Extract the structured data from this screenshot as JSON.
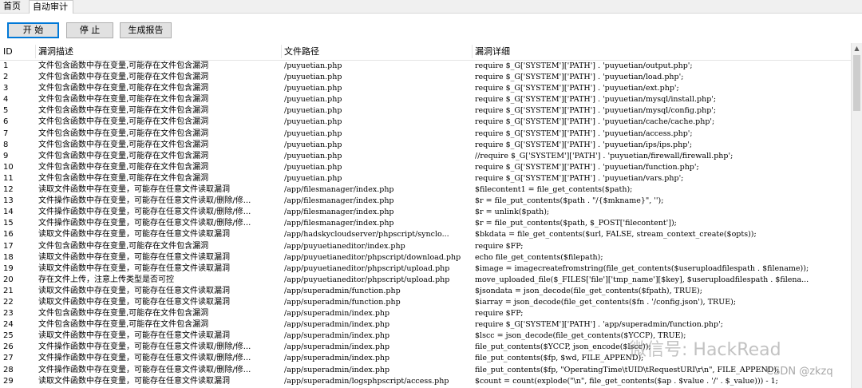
{
  "tabs": [
    {
      "label": "首页"
    },
    {
      "label": "自动审计"
    }
  ],
  "toolbar": {
    "start_label": "开 始",
    "stop_label": "停 止",
    "report_label": "生成报告"
  },
  "table": {
    "columns": [
      "ID",
      "漏洞描述",
      "文件路径",
      "漏洞详细"
    ],
    "rows": [
      [
        "1",
        "文件包含函数中存在变量,可能存在文件包含漏洞",
        "/puyuetian.php",
        "require $_G['SYSTEM']['PATH'] . 'puyuetian/output.php';"
      ],
      [
        "2",
        "文件包含函数中存在变量,可能存在文件包含漏洞",
        "/puyuetian.php",
        "require $_G['SYSTEM']['PATH'] . 'puyuetian/load.php';"
      ],
      [
        "3",
        "文件包含函数中存在变量,可能存在文件包含漏洞",
        "/puyuetian.php",
        "require $_G['SYSTEM']['PATH'] . 'puyuetian/ext.php';"
      ],
      [
        "4",
        "文件包含函数中存在变量,可能存在文件包含漏洞",
        "/puyuetian.php",
        "require $_G['SYSTEM']['PATH'] . 'puyuetian/mysql/install.php';"
      ],
      [
        "5",
        "文件包含函数中存在变量,可能存在文件包含漏洞",
        "/puyuetian.php",
        "require $_G['SYSTEM']['PATH'] . 'puyuetian/mysql/config.php';"
      ],
      [
        "6",
        "文件包含函数中存在变量,可能存在文件包含漏洞",
        "/puyuetian.php",
        "require $_G['SYSTEM']['PATH'] . 'puyuetian/cache/cache.php';"
      ],
      [
        "7",
        "文件包含函数中存在变量,可能存在文件包含漏洞",
        "/puyuetian.php",
        "require $_G['SYSTEM']['PATH'] . 'puyuetian/access.php';"
      ],
      [
        "8",
        "文件包含函数中存在变量,可能存在文件包含漏洞",
        "/puyuetian.php",
        "require $_G['SYSTEM']['PATH'] . 'puyuetian/ips/ips.php';"
      ],
      [
        "9",
        "文件包含函数中存在变量,可能存在文件包含漏洞",
        "/puyuetian.php",
        "//require $_G['SYSTEM']['PATH'] . 'puyuetian/firewall/firewall.php';"
      ],
      [
        "10",
        "文件包含函数中存在变量,可能存在文件包含漏洞",
        "/puyuetian.php",
        "require $_G['SYSTEM']['PATH'] . 'puyuetian/function.php';"
      ],
      [
        "11",
        "文件包含函数中存在变量,可能存在文件包含漏洞",
        "/puyuetian.php",
        "require $_G['SYSTEM']['PATH'] . 'puyuetian/vars.php';"
      ],
      [
        "12",
        "读取文件函数中存在变量，可能存在任意文件读取漏洞",
        "/app/filesmanager/index.php",
        "$filecontent1 = file_get_contents($path);"
      ],
      [
        "13",
        "文件操作函数中存在变量，可能存在任意文件读取/删除/修...",
        "/app/filesmanager/index.php",
        "$r = file_put_contents($path . \"/{$mkname}\", '');"
      ],
      [
        "14",
        "文件操作函数中存在变量，可能存在任意文件读取/删除/修...",
        "/app/filesmanager/index.php",
        "$r = unlink($path);"
      ],
      [
        "15",
        "文件操作函数中存在变量，可能存在任意文件读取/删除/修...",
        "/app/filesmanager/index.php",
        "$r = file_put_contents($path, $_POST['filecontent']);"
      ],
      [
        "16",
        "读取文件函数中存在变量，可能存在任意文件读取漏洞",
        "/app/hadskycloudserver/phpscript/synclo...",
        "$bkdata = file_get_contents($url, FALSE, stream_context_create($opts));"
      ],
      [
        "17",
        "文件包含函数中存在变量,可能存在文件包含漏洞",
        "/app/puyuetianeditor/index.php",
        "require $FP;"
      ],
      [
        "18",
        "读取文件函数中存在变量，可能存在任意文件读取漏洞",
        "/app/puyuetianeditor/phpscript/download.php",
        "echo file_get_contents($filepath);"
      ],
      [
        "19",
        "读取文件函数中存在变量，可能存在任意文件读取漏洞",
        "/app/puyuetianeditor/phpscript/upload.php",
        "$image = imagecreatefromstring(file_get_contents($useruploadfilespath . $filename));"
      ],
      [
        "20",
        "存在文件上传，注意上传类型是否可控",
        "/app/puyuetianeditor/phpscript/upload.php",
        "move_uploaded_file($_FILES['file']['tmp_name'][$key], $useruploadfilespath . $filena..."
      ],
      [
        "21",
        "读取文件函数中存在变量，可能存在任意文件读取漏洞",
        "/app/superadmin/function.php",
        "$jsondata = json_decode(file_get_contents($fpath), TRUE);"
      ],
      [
        "22",
        "读取文件函数中存在变量，可能存在任意文件读取漏洞",
        "/app/superadmin/function.php",
        "$iarray = json_decode(file_get_contents($fn . '/config.json'), TRUE);"
      ],
      [
        "23",
        "文件包含函数中存在变量,可能存在文件包含漏洞",
        "/app/superadmin/index.php",
        "require $FP;"
      ],
      [
        "24",
        "文件包含函数中存在变量,可能存在文件包含漏洞",
        "/app/superadmin/index.php",
        "require $_G['SYSTEM']['PATH'] . 'app/superadmin/function.php';"
      ],
      [
        "25",
        "读取文件函数中存在变量，可能存在任意文件读取漏洞",
        "/app/superadmin/index.php",
        "$lscc = json_decode(file_get_contents($YCCP), TRUE);"
      ],
      [
        "26",
        "文件操作函数中存在变量，可能存在任意文件读取/删除/修...",
        "/app/superadmin/index.php",
        "file_put_contents($YCCP, json_encode($lscc));"
      ],
      [
        "27",
        "文件操作函数中存在变量，可能存在任意文件读取/删除/修...",
        "/app/superadmin/index.php",
        "file_put_contents($fp, $wd, FILE_APPEND);"
      ],
      [
        "28",
        "文件操作函数中存在变量，可能存在任意文件读取/删除/修...",
        "/app/superadmin/index.php",
        "file_put_contents($fp, \"OperatingTime\\tUID\\tRequestURI\\r\\n\", FILE_APPEND);"
      ],
      [
        "29",
        "读取文件函数中存在变量，可能存在任意文件读取漏洞",
        "/app/superadmin/logsphpscript/access.php",
        "$count = count(explode(\"\\n\", file_get_contents($ap . $value . '/' . $_value))) - 1;"
      ]
    ]
  },
  "watermark": {
    "text": "微信号: HackRead",
    "csdn": "CSDN @zkzq"
  },
  "icons": {
    "scroll_up": "chevron-up-icon"
  }
}
